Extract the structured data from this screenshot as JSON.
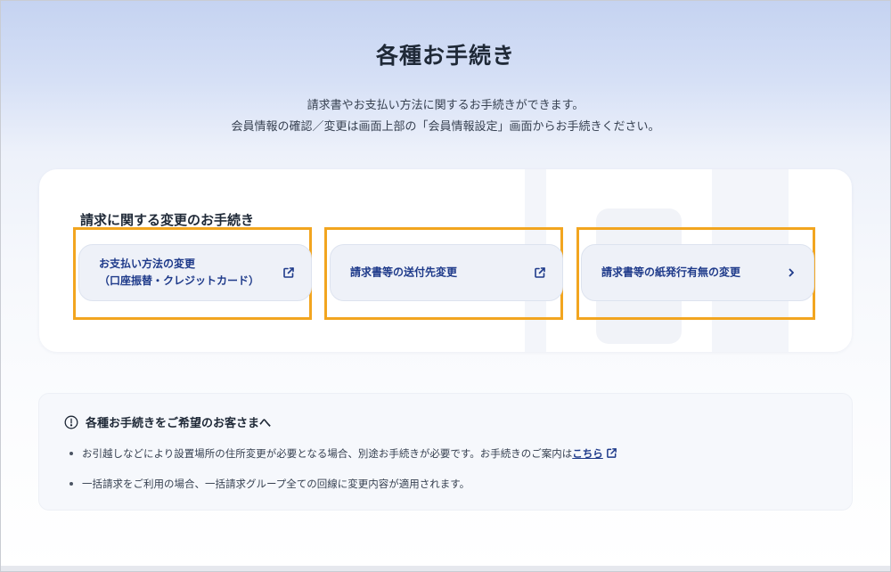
{
  "page": {
    "title": "各種お手続き",
    "lead_line1": "請求書やお支払い方法に関するお手続きができます。",
    "lead_line2": "会員情報の確認／変更は画面上部の「会員情報設定」画面からお手続きください。"
  },
  "billing_section": {
    "title": "請求に関する変更のお手続き",
    "buttons": [
      {
        "line1": "お支払い方法の変更",
        "line2": "（口座振替・クレジットカード）",
        "icon": "external-link-icon"
      },
      {
        "line1": "請求書等の送付先変更",
        "line2": "",
        "icon": "external-link-icon"
      },
      {
        "line1": "請求書等の紙発行有無の変更",
        "line2": "",
        "icon": "chevron-right-icon"
      }
    ]
  },
  "notice": {
    "title": "各種お手続きをご希望のお客さまへ",
    "icon": "info-circle-icon",
    "item1_text": "お引越しなどにより設置場所の住所変更が必要となる場合、別途お手続きが必要です。お手続きのご案内は",
    "item1_link": "こちら",
    "item2_text": "一括請求をご利用の場合、一括請求グループ全ての回線に変更内容が適用されます。"
  },
  "colors": {
    "accent": "#1e3a8a",
    "highlight": "#f2a51f",
    "button_bg": "#eef1f8"
  }
}
